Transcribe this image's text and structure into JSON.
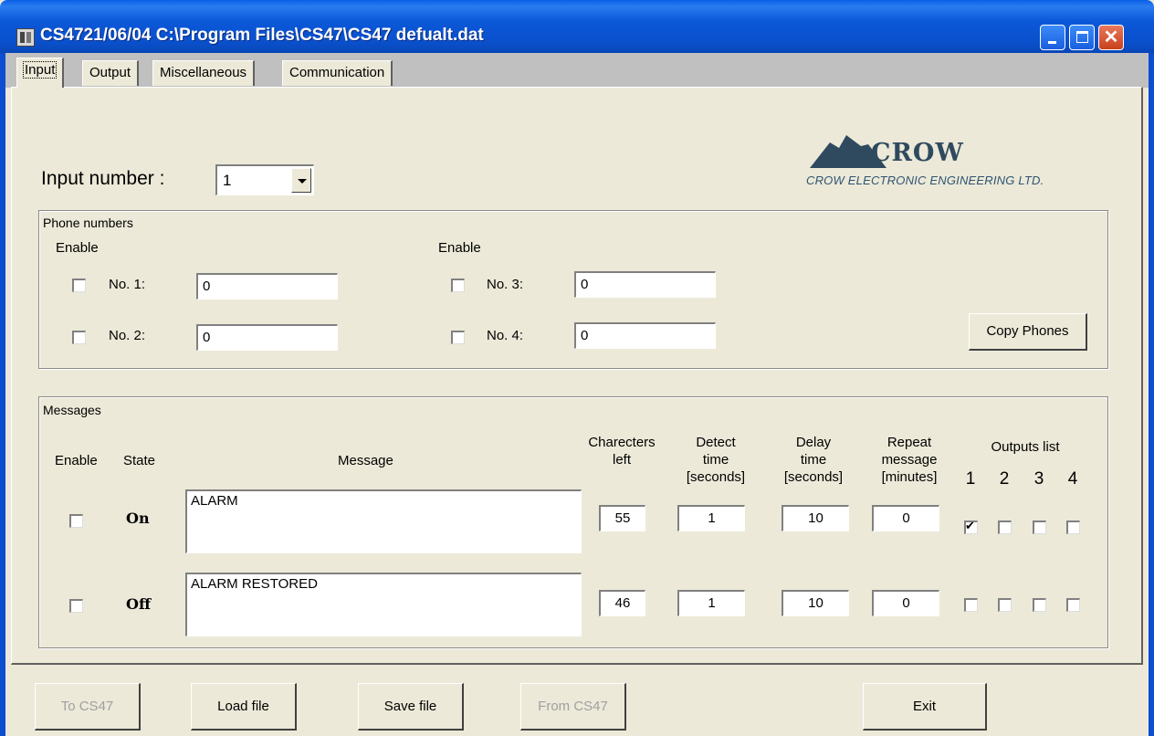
{
  "window": {
    "title": "CS4721/06/04  C:\\Program Files\\CS47\\CS47 defualt.dat"
  },
  "tabs": [
    {
      "label": "Input",
      "active": true
    },
    {
      "label": "Output"
    },
    {
      "label": "Miscellaneous"
    },
    {
      "label": "Communication"
    }
  ],
  "logo": {
    "word": "CROW",
    "company": "CROW ELECTRONIC ENGINEERING LTD."
  },
  "input_number": {
    "label": "Input number :",
    "value": "1"
  },
  "phone_numbers": {
    "title": "Phone numbers",
    "enable_label": "Enable",
    "entries": [
      {
        "label": "No. 1:",
        "value": "0",
        "enabled": false
      },
      {
        "label": "No. 2:",
        "value": "0",
        "enabled": false
      },
      {
        "label": "No. 3:",
        "value": "0",
        "enabled": false
      },
      {
        "label": "No. 4:",
        "value": "0",
        "enabled": false
      }
    ],
    "copy_button": "Copy Phones"
  },
  "messages": {
    "title": "Messages",
    "headers": {
      "enable": "Enable",
      "state": "State",
      "message": "Message",
      "chars_left_1": "Charecters",
      "chars_left_2": "left",
      "detect_1": "Detect",
      "detect_2": "time",
      "detect_3": "[seconds]",
      "delay_1": "Delay",
      "delay_2": "time",
      "delay_3": "[seconds]",
      "repeat_1": "Repeat",
      "repeat_2": "message",
      "repeat_3": "[minutes]",
      "outputs": "Outputs list",
      "out_1": "1",
      "out_2": "2",
      "out_3": "3",
      "out_4": "4"
    },
    "rows": [
      {
        "state": "On",
        "message": "ALARM",
        "chars_left": "55",
        "detect": "1",
        "delay": "10",
        "repeat": "0",
        "enabled": false,
        "outputs": [
          true,
          false,
          false,
          false
        ]
      },
      {
        "state": "Off",
        "message": "ALARM RESTORED",
        "chars_left": "46",
        "detect": "1",
        "delay": "10",
        "repeat": "0",
        "enabled": false,
        "outputs": [
          false,
          false,
          false,
          false
        ]
      }
    ]
  },
  "buttons": {
    "to_cs47": "To CS47",
    "load_file": "Load file",
    "save_file": "Save file",
    "from_cs47": "From CS47",
    "exit": "Exit"
  }
}
